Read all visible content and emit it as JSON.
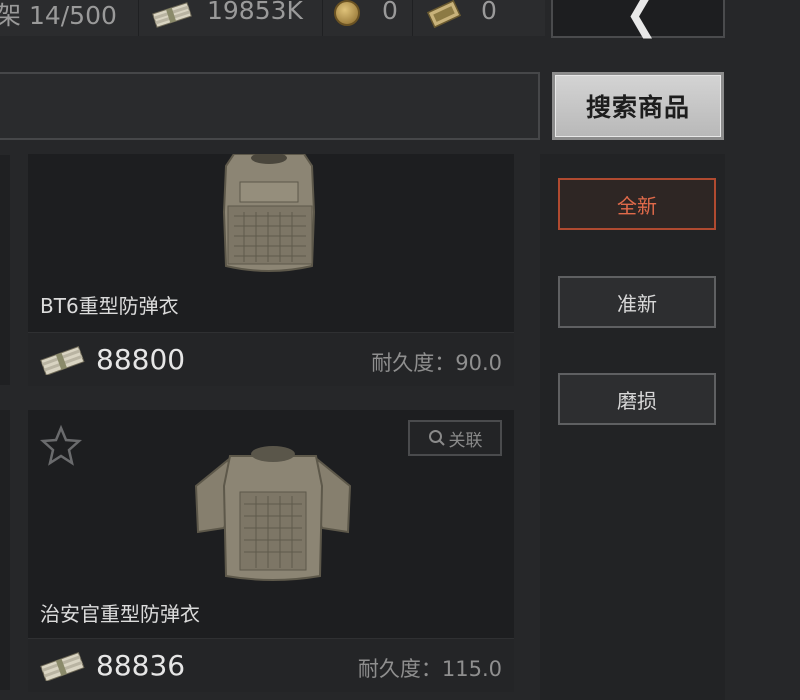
{
  "topbar": {
    "shelf_label": "架 14/500",
    "cash_amount": "19853K",
    "coin_amount": "0",
    "ticket_amount": "0"
  },
  "search": {
    "value": "",
    "button_label": "搜索商品"
  },
  "filters": [
    {
      "label": "全新",
      "active": true
    },
    {
      "label": "准新",
      "active": false
    },
    {
      "label": "磨损",
      "active": false
    }
  ],
  "items": [
    {
      "name": "BT6重型防弹衣",
      "price": "88800",
      "durability": "耐久度：90.0"
    },
    {
      "name": "治安官重型防弹衣",
      "price": "88836",
      "durability": "耐久度：115.0",
      "related_label": "关联"
    }
  ],
  "colors": {
    "accent_active": "#e06a4a",
    "background": "#262729"
  }
}
